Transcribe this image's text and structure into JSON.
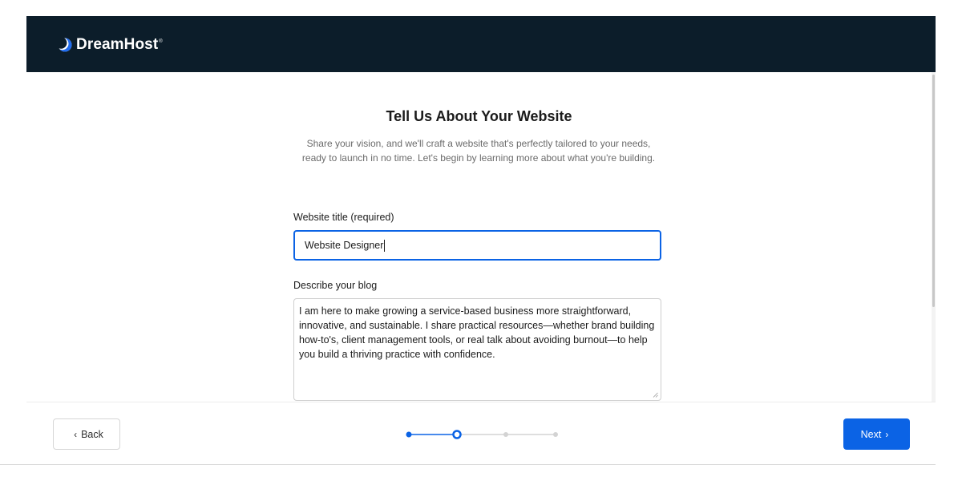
{
  "brand": {
    "name": "DreamHost",
    "trademark": "®",
    "bar_color": "#0c1d2a"
  },
  "page": {
    "title": "Tell Us About Your Website",
    "subtitle": "Share your vision, and we'll craft a website that's perfectly tailored to your needs, ready to launch in no time. Let's begin by learning more about what you're building."
  },
  "form": {
    "title_field": {
      "label": "Website title (required)",
      "value": "Website Designer"
    },
    "description_field": {
      "label": "Describe your blog",
      "value": "I am here to make growing a service-based business more straightforward, innovative, and sustainable. I share practical resources—whether brand building how-to's, client management tools, or real talk about avoiding burnout—to help you build a thriving practice with confidence."
    }
  },
  "footer": {
    "back_label": "Back",
    "back_icon": "chevron-left-icon",
    "next_label": "Next",
    "next_icon": "chevron-right-icon",
    "progress": {
      "total_steps": 4,
      "current_step": 2
    }
  },
  "colors": {
    "accent": "#0b63e5",
    "inactive_step": "#d3d3d3"
  }
}
